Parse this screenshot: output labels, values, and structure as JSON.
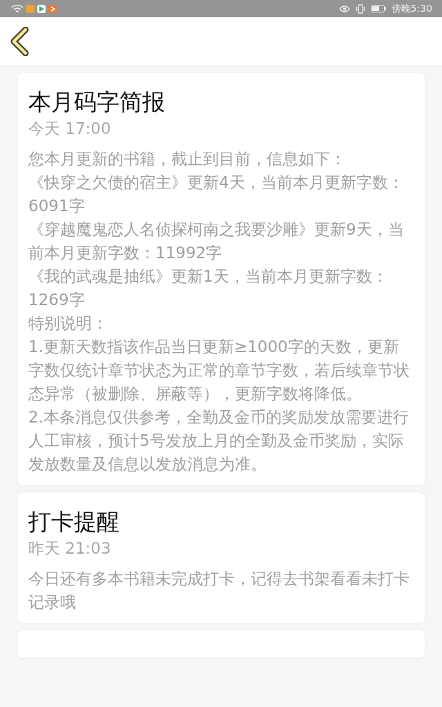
{
  "status_bar": {
    "time": "傍晚5:30"
  },
  "messages": [
    {
      "title": "本月码字简报",
      "time": "今天 17:00",
      "paragraphs": [
        "您本月更新的书籍，截止到目前，信息如下：",
        "《快穿之欠债的宿主》更新4天，当前本月更新字数：6091字",
        "《穿越魔鬼恋人名侦探柯南之我要沙雕》更新9天，当前本月更新字数：11992字",
        "《我的武魂是抽纸》更新1天，当前本月更新字数：1269字",
        "特别说明：",
        "1.更新天数指该作品当日更新≥1000字的天数，更新字数仅统计章节状态为正常的章节字数，若后续章节状态异常（被删除、屏蔽等），更新字数将降低。",
        "2.本条消息仅供参考，全勤及金币的奖励发放需要进行人工审核，预计5号发放上月的全勤及金币奖励，实际发放数量及信息以发放消息为准。"
      ]
    },
    {
      "title": "打卡提醒",
      "time": "昨天 21:03",
      "paragraphs": [
        "今日还有多本书籍未完成打卡，记得去书架看看未打卡记录哦"
      ]
    }
  ]
}
